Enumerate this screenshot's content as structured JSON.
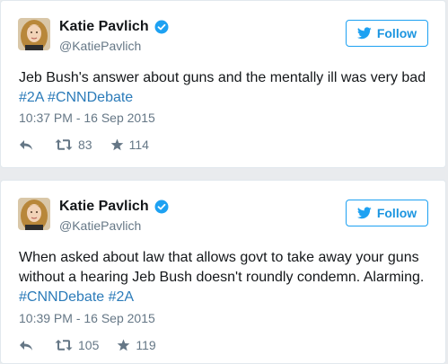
{
  "colors": {
    "link_blue": "#2b7bb9",
    "follow_blue": "#1da1f2",
    "text_dark": "#14171a",
    "text_gray": "#657786",
    "background": "#e9ebee"
  },
  "icons": {
    "verified": "verified-badge-icon",
    "follow": "twitter-bird-icon",
    "reply": "reply-arrow-icon",
    "retweet": "retweet-icon",
    "like": "star-icon"
  },
  "tweets": [
    {
      "author": {
        "name": "Katie Pavlich",
        "handle": "@KatiePavlich"
      },
      "follow_label": "Follow",
      "text": "Jeb Bush's answer about guns and the mentally ill was very bad",
      "hashtags": [
        "#2A",
        "#CNNDebate"
      ],
      "timestamp": "10:37 PM - 16 Sep 2015",
      "retweets": "83",
      "likes": "114"
    },
    {
      "author": {
        "name": "Katie Pavlich",
        "handle": "@KatiePavlich"
      },
      "follow_label": "Follow",
      "text": "When asked about law that allows govt to take away your guns without a hearing Jeb Bush doesn't roundly condemn. Alarming.",
      "hashtags": [
        "#CNNDebate",
        "#2A"
      ],
      "timestamp": "10:39 PM - 16 Sep 2015",
      "retweets": "105",
      "likes": "119"
    }
  ]
}
